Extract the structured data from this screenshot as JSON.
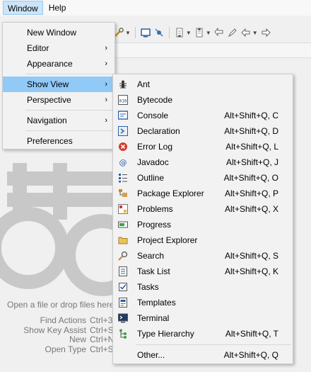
{
  "menubar": {
    "window": "Window",
    "help": "Help"
  },
  "window_menu": {
    "items": [
      {
        "label": "New Window",
        "arrow": ""
      },
      {
        "label": "Editor",
        "arrow": "›"
      },
      {
        "label": "Appearance",
        "arrow": "›"
      },
      {
        "label": "Show View",
        "arrow": "›"
      },
      {
        "label": "Perspective",
        "arrow": "›"
      },
      {
        "label": "Navigation",
        "arrow": "›"
      },
      {
        "label": "Preferences",
        "arrow": ""
      }
    ]
  },
  "show_view_menu": {
    "items": [
      {
        "label": "Ant",
        "shortcut": "",
        "icon": "ant-icon"
      },
      {
        "label": "Bytecode",
        "shortcut": "",
        "icon": "bytecode-icon"
      },
      {
        "label": "Console",
        "shortcut": "Alt+Shift+Q, C",
        "icon": "console-icon"
      },
      {
        "label": "Declaration",
        "shortcut": "Alt+Shift+Q, D",
        "icon": "declaration-icon"
      },
      {
        "label": "Error Log",
        "shortcut": "Alt+Shift+Q, L",
        "icon": "error-log-icon"
      },
      {
        "label": "Javadoc",
        "shortcut": "Alt+Shift+Q, J",
        "icon": "javadoc-icon"
      },
      {
        "label": "Outline",
        "shortcut": "Alt+Shift+Q, O",
        "icon": "outline-icon"
      },
      {
        "label": "Package Explorer",
        "shortcut": "Alt+Shift+Q, P",
        "icon": "package-explorer-icon"
      },
      {
        "label": "Problems",
        "shortcut": "Alt+Shift+Q, X",
        "icon": "problems-icon"
      },
      {
        "label": "Progress",
        "shortcut": "",
        "icon": "progress-icon"
      },
      {
        "label": "Project Explorer",
        "shortcut": "",
        "icon": "project-explorer-icon"
      },
      {
        "label": "Search",
        "shortcut": "Alt+Shift+Q, S",
        "icon": "search-icon"
      },
      {
        "label": "Task List",
        "shortcut": "Alt+Shift+Q, K",
        "icon": "task-list-icon"
      },
      {
        "label": "Tasks",
        "shortcut": "",
        "icon": "tasks-icon"
      },
      {
        "label": "Templates",
        "shortcut": "",
        "icon": "templates-icon"
      },
      {
        "label": "Terminal",
        "shortcut": "",
        "icon": "terminal-icon"
      },
      {
        "label": "Type Hierarchy",
        "shortcut": "Alt+Shift+Q, T",
        "icon": "type-hierarchy-icon"
      },
      {
        "label": "Other...",
        "shortcut": "Alt+Shift+Q, Q",
        "icon": ""
      }
    ]
  },
  "editor": {
    "hint": "Open a file or drop files here",
    "shortcuts": [
      {
        "label": "Find Actions",
        "keys": "Ctrl+3"
      },
      {
        "label": "Show Key Assist",
        "keys": "Ctrl+Shift+L"
      },
      {
        "label": "New",
        "keys": "Ctrl+N"
      },
      {
        "label": "Open Type",
        "keys": "Ctrl+Shift+T"
      }
    ]
  },
  "colors": {
    "highlight": "#91c9f7",
    "menubar_active": "#cce4f7"
  }
}
